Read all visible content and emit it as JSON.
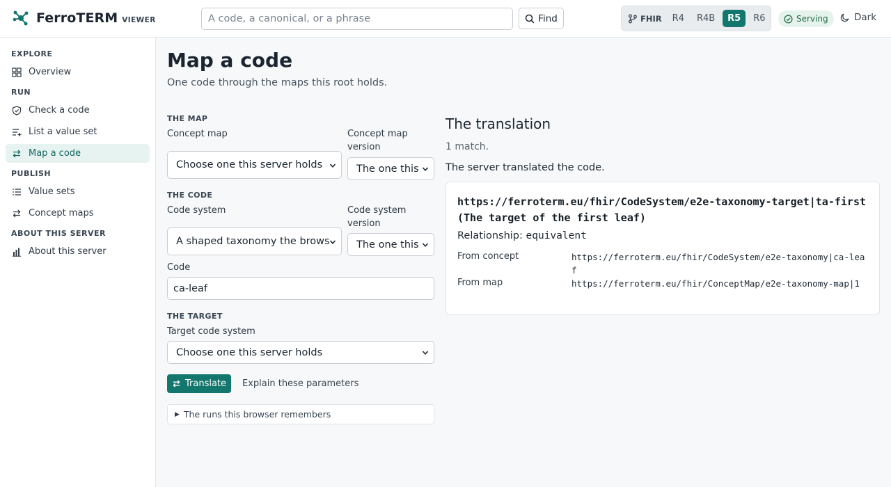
{
  "header": {
    "brand_name": "FerroTERM",
    "brand_sub": "VIEWER",
    "search_placeholder": "A code, a canonical, or a phrase",
    "find_label": "Find",
    "fhir_label": "FHIR",
    "versions": [
      "R4",
      "R4B",
      "R5",
      "R6"
    ],
    "active_version": "R5",
    "status": "Serving",
    "theme_toggle": "Dark"
  },
  "sidebar": {
    "sections": {
      "explore": "EXPLORE",
      "run": "RUN",
      "publish": "PUBLISH",
      "about": "ABOUT THIS SERVER"
    },
    "items": {
      "overview": "Overview",
      "check_code": "Check a code",
      "list_value_set": "List a value set",
      "map_code": "Map a code",
      "value_sets": "Value sets",
      "concept_maps": "Concept maps",
      "about_server": "About this server"
    },
    "active_item": "Map a code"
  },
  "main": {
    "title": "Map a code",
    "subtitle": "One code through the maps this root holds.",
    "map_section": "THE MAP",
    "concept_map_label": "Concept map",
    "concept_map_value": "Choose one this server holds",
    "concept_map_version_label": "Concept map version",
    "concept_map_version_value": "The one this",
    "code_section": "THE CODE",
    "code_system_label": "Code system",
    "code_system_value": "A shaped taxonomy the brows",
    "code_system_version_label": "Code system version",
    "code_system_version_value": "The one this",
    "code_label": "Code",
    "code_value": "ca-leaf",
    "target_section": "THE TARGET",
    "target_label": "Target code system",
    "target_value": "Choose one this server holds",
    "translate_label": "Translate",
    "explain_label": "Explain these parameters",
    "history_label": "The runs this browser remembers"
  },
  "result": {
    "title": "The translation",
    "count": "1 match.",
    "note": "The server translated the code.",
    "heading": "https://ferroterm.eu/fhir/CodeSystem/e2e-taxonomy-target|ta-first (The target of the first leaf)",
    "relationship_label": "Relationship:",
    "relationship_value": "equivalent",
    "from_concept_label": "From concept",
    "from_concept_value": "https://ferroterm.eu/fhir/CodeSystem/e2e-taxonomy|ca-leaf",
    "from_map_label": "From map",
    "from_map_value": "https://ferroterm.eu/fhir/ConceptMap/e2e-taxonomy-map|1"
  },
  "colors": {
    "accent": "#13776d",
    "accent_soft": "#e7f3f1",
    "serving_bg": "#e5f3ec",
    "serving_fg": "#1f6e43"
  },
  "icons": {
    "brand": "molecule-logo-icon",
    "find": "search-icon",
    "fhir": "branch-icon",
    "status": "check-circle-icon",
    "theme": "moon-icon",
    "overview": "grid-icon",
    "check_code": "shield-check-icon",
    "list_value_set": "list-add-icon",
    "map_code": "arrows-swap-icon",
    "value_sets": "list-icon",
    "concept_maps": "arrows-swap-icon",
    "about_server": "bar-chart-icon"
  }
}
